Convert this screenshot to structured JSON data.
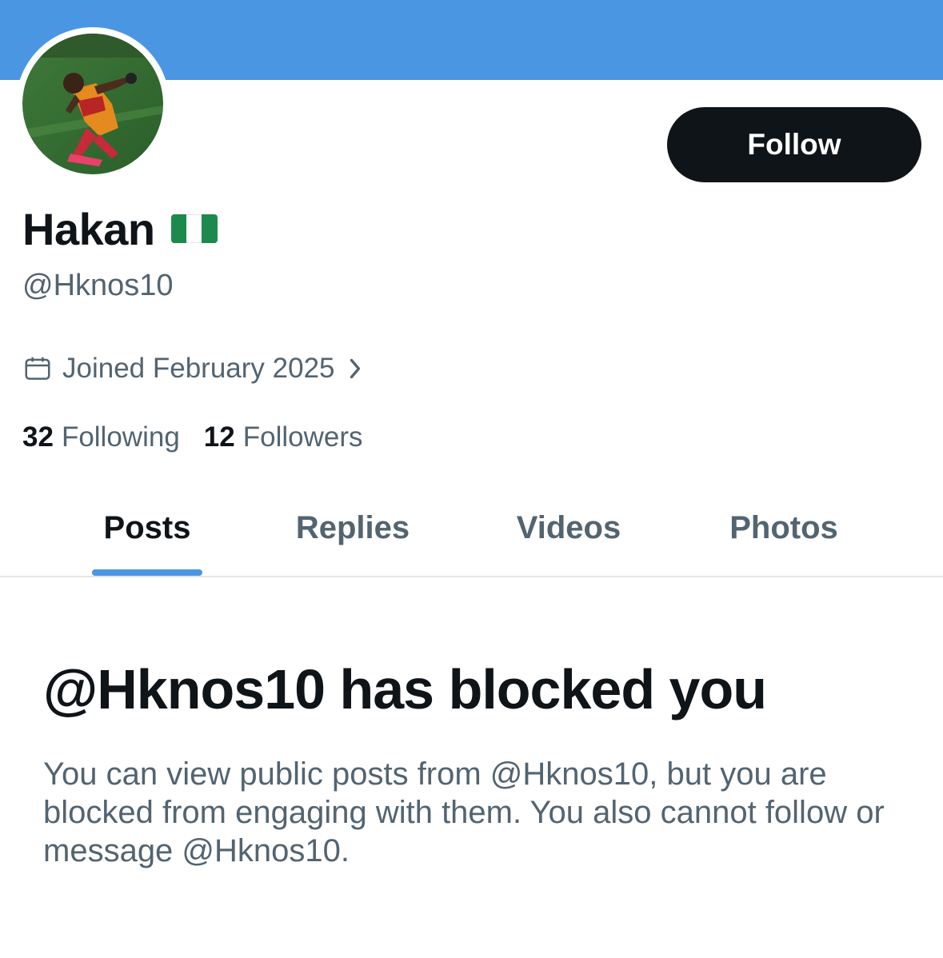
{
  "colors": {
    "banner": "#4a96e3",
    "text_primary": "#0f1419",
    "text_secondary": "#536471",
    "accent": "#4a96e3",
    "follow_button_bg": "#0f1419",
    "flag_green": "#1d8a4d",
    "flag_white": "#ffffff"
  },
  "profile": {
    "display_name": "Hakan",
    "flag_icon": "nigeria-flag",
    "handle": "@Hknos10",
    "joined": {
      "icon": "calendar-icon",
      "text": "Joined February 2025",
      "chevron_icon": "chevron-right-icon"
    },
    "stats": {
      "following_count": "32",
      "following_label": "Following",
      "followers_count": "12",
      "followers_label": "Followers"
    }
  },
  "actions": {
    "follow_label": "Follow"
  },
  "tabs": [
    {
      "label": "Posts",
      "active": true
    },
    {
      "label": "Replies",
      "active": false
    },
    {
      "label": "Videos",
      "active": false
    },
    {
      "label": "Photos",
      "active": false
    }
  ],
  "blocked_notice": {
    "title": "@Hknos10 has blocked you",
    "body": "You can view public posts from @Hknos10, but you are blocked from engaging with them. You also cannot follow or message @Hknos10."
  }
}
